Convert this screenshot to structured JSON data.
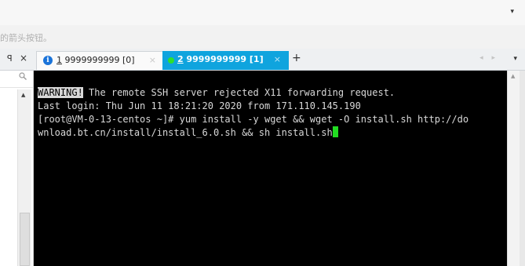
{
  "topbar": {
    "dropdown_icon": "▾"
  },
  "hint": {
    "text": "的箭头按钮。"
  },
  "panel": {
    "pin_icon": "ꟼ",
    "close_icon": "×"
  },
  "tabs": [
    {
      "index": "1",
      "name": "9999999999",
      "session": "[0]",
      "status": "info",
      "close": "×"
    },
    {
      "index": "2",
      "name": "9999999999",
      "session": "[1]",
      "status": "connected",
      "close": "×"
    }
  ],
  "tabbar": {
    "add_label": "+",
    "nav_arrows": "◂ ▸",
    "menu_icon": "▾"
  },
  "terminal": {
    "warning": "WARNING!",
    "line1_rest": " The remote SSH server rejected X11 forwarding request.",
    "line2": "Last login: Thu Jun 11 18:21:20 2020 from 171.110.145.190",
    "line3": "[root@VM-0-13-centos ~]# yum install -y wget && wget -O install.sh http://do",
    "line4": "wnload.bt.cn/install/install_6.0.sh && sh install.sh"
  },
  "colors": {
    "active_tab": "#0fa4de",
    "terminal_bg": "#000000",
    "terminal_fg": "#d8d8d8",
    "cursor": "#22dd22",
    "info_icon": "#1a73d9"
  }
}
